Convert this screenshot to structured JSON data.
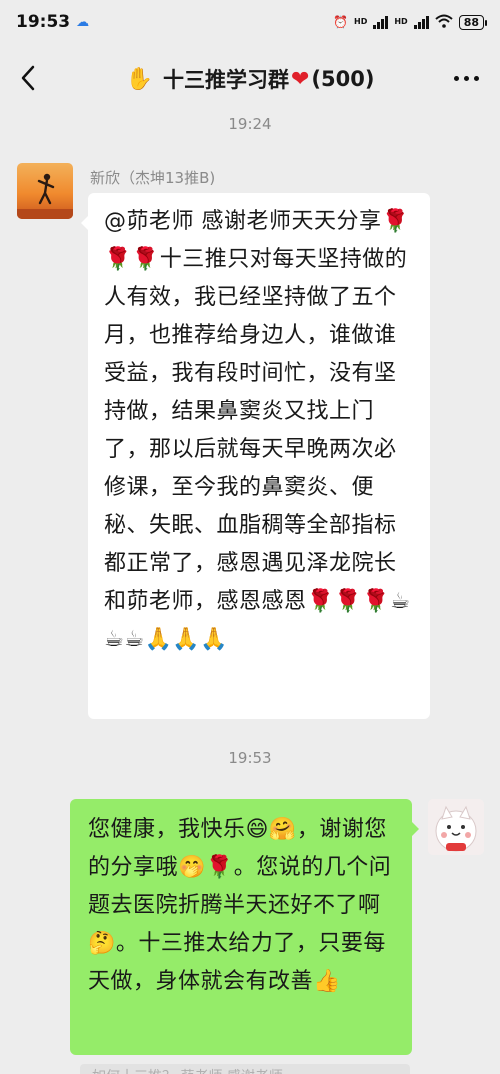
{
  "status_bar": {
    "time": "19:53",
    "hd_1": "HD",
    "hd_2": "HD",
    "battery": "88"
  },
  "nav": {
    "title": "十三推学习群",
    "member_count": "(500)"
  },
  "chat": {
    "timestamp_1": "19:24",
    "timestamp_2": "19:53",
    "incoming": {
      "sender": "新欣（杰坤13推B)",
      "text": "@茆老师  感谢老师天天分享🌹🌹🌹十三推只对每天坚持做的人有效，我已经坚持做了五个月，也推荐给身边人，谁做谁受益，我有段时间忙，没有坚持做，结果鼻窦炎又找上门了，那以后就每天早晚两次必修课，至今我的鼻窦炎、便秘、失眠、血脂稠等全部指标都正常了，感恩遇见泽龙院长和茆老师，感恩感恩🌹🌹🌹☕☕☕🙏🙏🙏"
    },
    "outgoing": {
      "text": "您健康，我快乐😄🤗，谢谢您的分享哦🤭🌹。您说的几个问题去医院折腾半天还好不了啊🤔。十三推太给力了，只要每天做，身体就会有改善👍"
    },
    "partial": {
      "text": "如何十三推？  茆老师  感谢老师"
    }
  }
}
